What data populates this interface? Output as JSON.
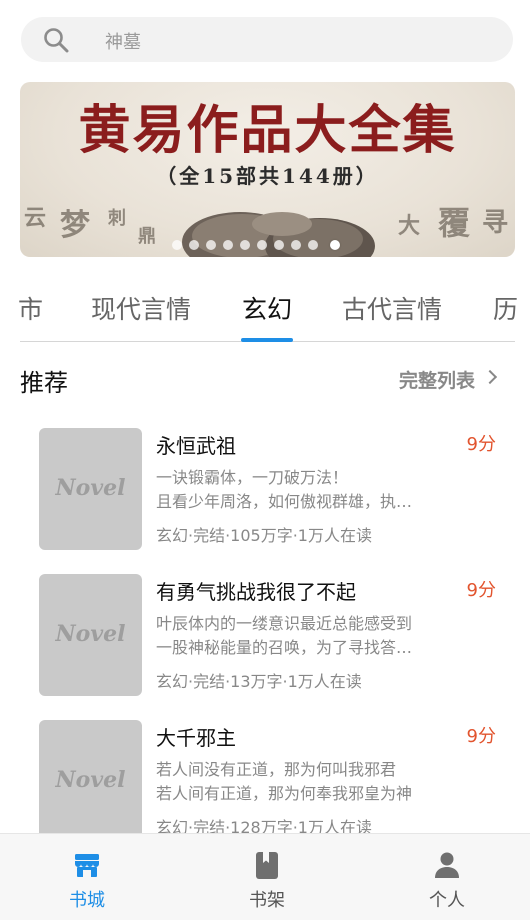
{
  "search": {
    "placeholder": "神墓",
    "icon": "search-icon"
  },
  "banner": {
    "title": "黄易作品大全集",
    "subtitle": "（全15部共144册）",
    "side_text_left_1": "云",
    "side_text_left_2": "梦",
    "side_text_left_3": "刺",
    "side_text_left_4": "鼎",
    "side_text_right_1": "大",
    "side_text_right_2": "覆",
    "side_text_right_3": "寻",
    "slides_total": 10,
    "active_slide": 10
  },
  "tabs": [
    {
      "label": "市"
    },
    {
      "label": "现代言情"
    },
    {
      "label": "玄幻"
    },
    {
      "label": "古代言情"
    },
    {
      "label": "历"
    }
  ],
  "active_tab": "玄幻",
  "section": {
    "title": "推荐",
    "more_label": "完整列表"
  },
  "books": [
    {
      "title": "永恒武祖",
      "score": "9分",
      "desc_line1": "一诀锻霸体，一刀破万法！",
      "desc_line2": "且看少年周洛，如何傲视群雄，执…",
      "meta": "玄幻·完结·105万字·1万人在读",
      "cover_text": "Novel"
    },
    {
      "title": "有勇气挑战我很了不起",
      "score": "9分",
      "desc_line1": "叶辰体内的一缕意识最近总能感受到",
      "desc_line2": "一股神秘能量的召唤，为了寻找答…",
      "meta": "玄幻·完结·13万字·1万人在读",
      "cover_text": "Novel"
    },
    {
      "title": "大千邪主",
      "score": "9分",
      "desc_line1": "若人间没有正道，那为何叫我邪君",
      "desc_line2": "若人间有正道，那为何奉我邪皇为神",
      "meta": "玄幻·完结·128万字·1万人在读",
      "cover_text": "Novel"
    }
  ],
  "nav": [
    {
      "label": "书城",
      "icon": "store-icon",
      "active": true
    },
    {
      "label": "书架",
      "icon": "bookshelf-icon",
      "active": false
    },
    {
      "label": "个人",
      "icon": "person-icon",
      "active": false
    }
  ],
  "colors": {
    "accent": "#1e8ee6",
    "score": "#e2542e",
    "banner_title": "#8b1d1d"
  }
}
